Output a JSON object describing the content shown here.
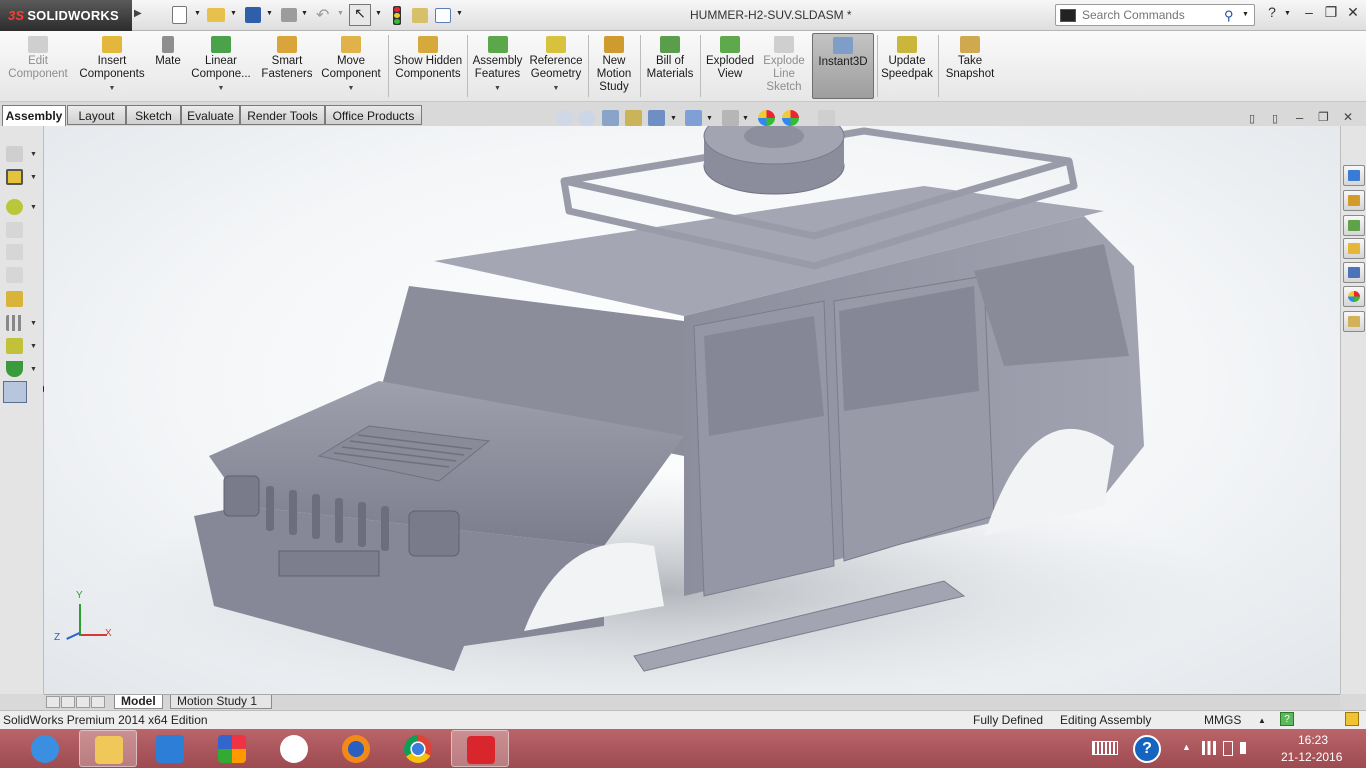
{
  "app": {
    "logo_text": "SOLIDWORKS",
    "document_title": "HUMMER-H2-SUV.SLDASM *"
  },
  "search": {
    "placeholder": "Search Commands"
  },
  "command_manager": {
    "buttons": [
      {
        "label": "Edit Component",
        "state": "disabled",
        "icon": "edit-component-icon"
      },
      {
        "label": "Insert Components",
        "state": "enabled",
        "icon": "insert-components-icon"
      },
      {
        "label": "Mate",
        "state": "enabled",
        "icon": "mate-icon"
      },
      {
        "label": "Linear Compone...",
        "state": "enabled",
        "icon": "linear-pattern-icon"
      },
      {
        "label": "Smart Fasteners",
        "state": "enabled",
        "icon": "smart-fasteners-icon"
      },
      {
        "label": "Move Component",
        "state": "enabled",
        "icon": "move-component-icon"
      },
      {
        "label": "Show Hidden Components",
        "state": "enabled",
        "icon": "show-hidden-icon"
      },
      {
        "label": "Assembly Features",
        "state": "enabled",
        "icon": "assembly-features-icon"
      },
      {
        "label": "Reference Geometry",
        "state": "enabled",
        "icon": "reference-geometry-icon"
      },
      {
        "label": "New Motion Study",
        "state": "enabled",
        "icon": "motion-study-icon"
      },
      {
        "label": "Bill of Materials",
        "state": "enabled",
        "icon": "bom-icon"
      },
      {
        "label": "Exploded View",
        "state": "enabled",
        "icon": "exploded-view-icon"
      },
      {
        "label": "Explode Line Sketch",
        "state": "disabled",
        "icon": "explode-line-icon"
      },
      {
        "label": "Instant3D",
        "state": "active",
        "icon": "instant3d-icon"
      },
      {
        "label": "Update Speedpak",
        "state": "enabled",
        "icon": "speedpak-icon"
      },
      {
        "label": "Take Snapshot",
        "state": "enabled",
        "icon": "snapshot-icon"
      }
    ]
  },
  "tabs": [
    "Assembly",
    "Layout",
    "Sketch",
    "Evaluate",
    "Render Tools",
    "Office Products"
  ],
  "active_tab": "Assembly",
  "bottom_tabs": [
    "Model",
    "Motion Study 1"
  ],
  "triad": {
    "x": "X",
    "y": "Y",
    "z": "Z"
  },
  "status": {
    "edition": "SolidWorks Premium 2014 x64 Edition",
    "definition": "Fully Defined",
    "mode": "Editing Assembly",
    "units": "MMGS",
    "help": "?"
  },
  "taskbar": {
    "apps": [
      "internet-explorer-icon",
      "file-explorer-icon",
      "app-launcher-icon",
      "photo-app-icon",
      "hp-icon",
      "firefox-icon",
      "chrome-icon",
      "solidworks-icon"
    ],
    "time": "16:23",
    "date": "21-12-2016"
  },
  "colors": {
    "model_gray": "#8e8f9e",
    "taskbar": "#a85358",
    "accent_blue": "#1f4fa0"
  }
}
